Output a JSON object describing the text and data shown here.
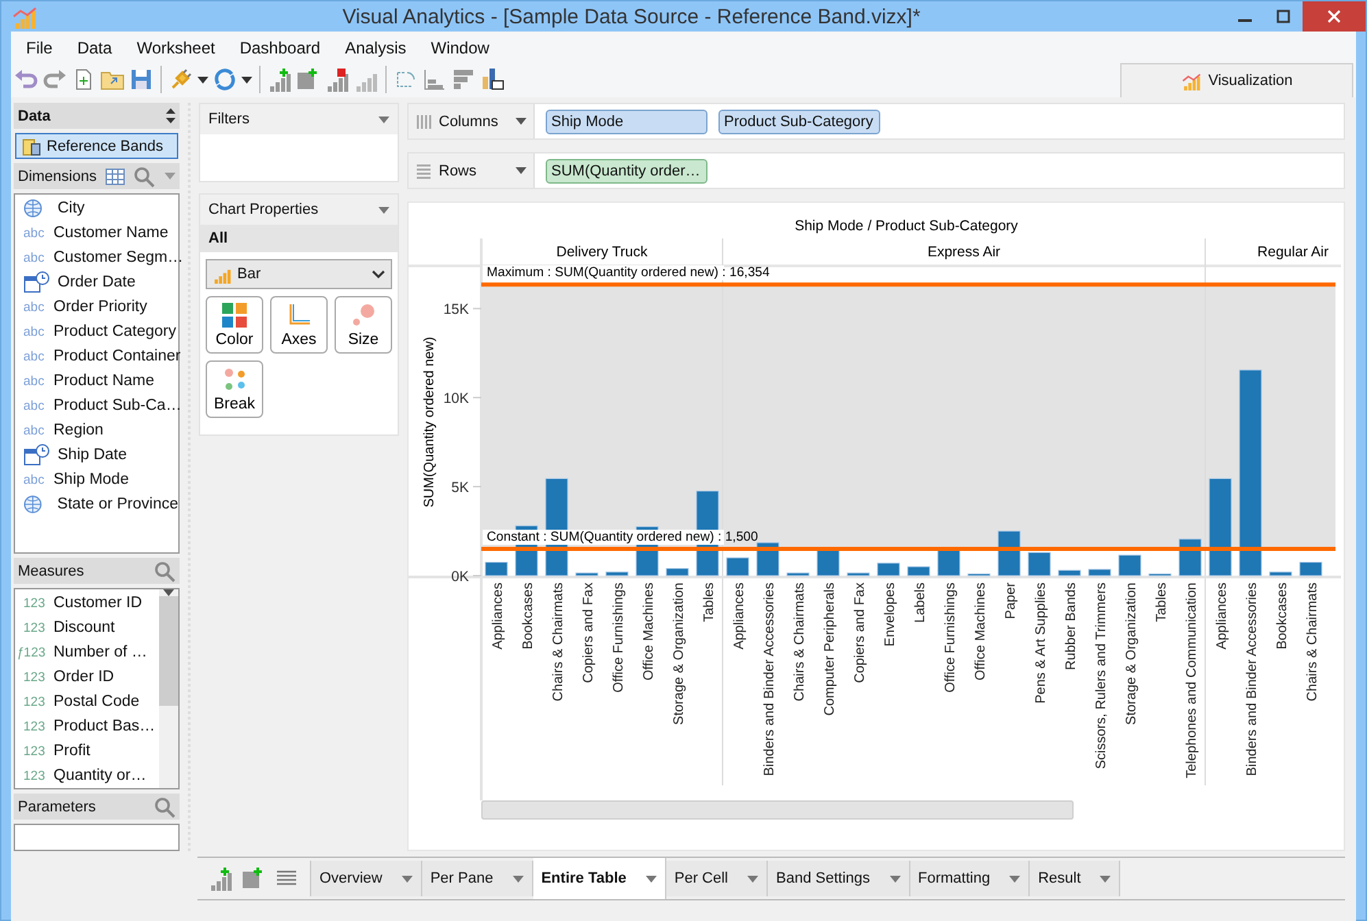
{
  "window": {
    "title": "Visual Analytics - [Sample Data Source - Reference Band.vizx]*"
  },
  "menu": [
    "File",
    "Data",
    "Worksheet",
    "Dashboard",
    "Analysis",
    "Window"
  ],
  "view_tab": {
    "label": "Visualization",
    "selected": true
  },
  "data_panel": {
    "title": "Data",
    "source": {
      "label": "Reference Bands",
      "selected": true
    }
  },
  "dimensions": {
    "title": "Dimensions",
    "items": [
      {
        "label": "City",
        "kind": "geo"
      },
      {
        "label": "Customer Name",
        "kind": "string",
        "badge": "abc"
      },
      {
        "label": "Customer Segm…",
        "kind": "string",
        "badge": "abc"
      },
      {
        "label": "Order Date",
        "kind": "date"
      },
      {
        "label": "Order Priority",
        "kind": "string",
        "badge": "abc"
      },
      {
        "label": "Product Category",
        "kind": "string",
        "badge": "abc"
      },
      {
        "label": "Product Container",
        "kind": "string",
        "badge": "abc"
      },
      {
        "label": "Product Name",
        "kind": "string",
        "badge": "abc"
      },
      {
        "label": "Product Sub-Ca…",
        "kind": "string",
        "badge": "abc"
      },
      {
        "label": "Region",
        "kind": "string",
        "badge": "abc"
      },
      {
        "label": "Ship Date",
        "kind": "date"
      },
      {
        "label": "Ship Mode",
        "kind": "string",
        "badge": "abc"
      },
      {
        "label": "State or Province",
        "kind": "geo"
      }
    ]
  },
  "measures": {
    "title": "Measures",
    "items": [
      {
        "label": "Customer ID",
        "kind": "number",
        "badge": "123"
      },
      {
        "label": "Discount",
        "kind": "number",
        "badge": "123"
      },
      {
        "label": "Number of …",
        "kind": "calculated",
        "prefix": "ƒ",
        "badge": "123"
      },
      {
        "label": "Order ID",
        "kind": "number",
        "badge": "123"
      },
      {
        "label": "Postal Code",
        "kind": "number",
        "badge": "123"
      },
      {
        "label": "Product Bas…",
        "kind": "number",
        "badge": "123"
      },
      {
        "label": "Profit",
        "kind": "number",
        "badge": "123"
      },
      {
        "label": "Quantity or…",
        "kind": "number",
        "badge": "123"
      }
    ]
  },
  "parameters": {
    "title": "Parameters"
  },
  "filters": {
    "title": "Filters"
  },
  "chart_properties": {
    "title": "Chart Properties",
    "scope": "All",
    "mark_type": "Bar",
    "buttons": [
      {
        "label": "Color",
        "kind": "color"
      },
      {
        "label": "Axes",
        "kind": "axes"
      },
      {
        "label": "Size",
        "kind": "size"
      },
      {
        "label": "Break",
        "kind": "break"
      }
    ]
  },
  "shelves": [
    {
      "label": "Columns",
      "pills": [
        {
          "label": "Ship Mode",
          "kind": "dimension"
        },
        {
          "label": "Product Sub-Category",
          "kind": "dimension"
        }
      ]
    },
    {
      "label": "Rows",
      "pills": [
        {
          "label": "SUM(Quantity order…",
          "kind": "measure"
        }
      ]
    }
  ],
  "chart_data": {
    "type": "bar",
    "title": "Ship Mode / Product Sub-Category",
    "ylabel": "SUM(Quantity ordered new)",
    "categories": [
      "Appliances",
      "Bookcases",
      "Chairs & Chairmats",
      "Copiers and Fax",
      "Office Furnishings",
      "Office Machines",
      "Storage & Organization",
      "Tables",
      "Appliances",
      "Binders and Binder Accessories",
      "Chairs & Chairmats",
      "Computer Peripherals",
      "Copiers and Fax",
      "Envelopes",
      "Labels",
      "Office Furnishings",
      "Office Machines",
      "Paper",
      "Pens & Art Supplies",
      "Rubber Bands",
      "Scissors, Rulers and Trimmers",
      "Storage & Organization",
      "Tables",
      "Telephones and Communication",
      "Appliances",
      "Binders and Binder Accessories",
      "Bookcases",
      "Chairs & Chairmats"
    ],
    "series": [
      {
        "color": "#1f77b4",
        "values": [
          750,
          2800,
          5450,
          150,
          200,
          2750,
          400,
          4750,
          1000,
          1850,
          150,
          1450,
          150,
          700,
          500,
          1450,
          100,
          2500,
          1300,
          300,
          350,
          1150,
          100,
          2050,
          5450,
          11550,
          200,
          750
        ]
      }
    ],
    "ylim": [
      0,
      17400
    ],
    "yticks": [
      {
        "value": 0,
        "label": "0K"
      },
      {
        "value": 5000,
        "label": "5K"
      },
      {
        "value": 10000,
        "label": "10K"
      },
      {
        "value": 15000,
        "label": "15K"
      }
    ],
    "bands": [
      {
        "axis": "y",
        "from": 1500,
        "to": 16354
      }
    ],
    "ref_lines": [
      {
        "axis": "y",
        "value": 16354,
        "label": "Maximum : SUM(Quantity ordered new) : 16,354"
      },
      {
        "axis": "y",
        "value": 1500,
        "label": "Constant : SUM(Quantity ordered new) : 1,500"
      }
    ]
  },
  "column_headers": [
    {
      "label": "Delivery Truck"
    },
    {
      "label": "Express Air"
    },
    {
      "label": "Regular Air"
    }
  ],
  "band_tabs": [
    {
      "label": "Overview",
      "selected": false
    },
    {
      "label": "Per Pane",
      "selected": false
    },
    {
      "label": "Entire Table",
      "selected": true
    },
    {
      "label": "Per Cell",
      "selected": false
    },
    {
      "label": "Band Settings",
      "selected": false
    },
    {
      "label": "Formatting",
      "selected": false
    },
    {
      "label": "Result",
      "selected": false
    }
  ]
}
